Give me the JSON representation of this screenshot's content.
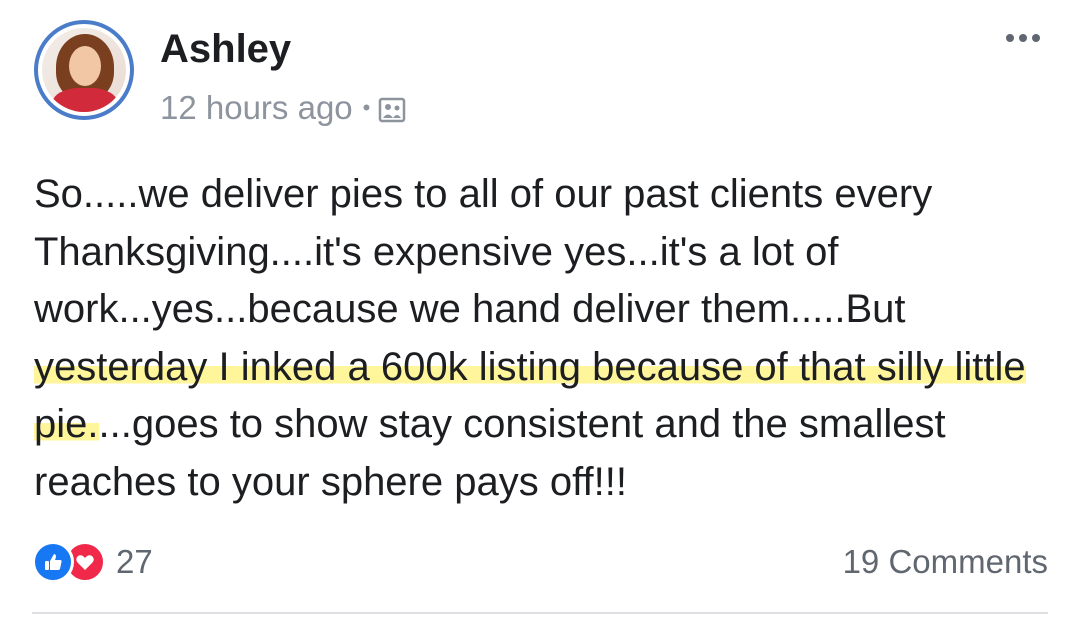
{
  "post": {
    "author_name": "Ashley",
    "timestamp": "12 hours ago",
    "separator": "•",
    "audience_icon": "friends-image-icon",
    "text_before": "So.....we deliver pies to all of our past clients every Thanksgiving....it's expensive yes...it's a lot of work...yes...because we hand deliver them.....But ",
    "text_highlighted": "yesterday I inked a 600k listing because of that silly little pie.",
    "text_after": "...goes to show stay consistent and the smallest reaches to your sphere pays off!!!",
    "highlight_color": "#fff59a"
  },
  "reactions": {
    "types": [
      "like-icon",
      "love-icon"
    ],
    "count": "27",
    "like_color": "#1877f2",
    "love_color": "#f0284a"
  },
  "comments": {
    "label": "19 Comments"
  },
  "colors": {
    "avatar_ring": "#4a7cc9",
    "secondary_text": "#8d949e"
  }
}
